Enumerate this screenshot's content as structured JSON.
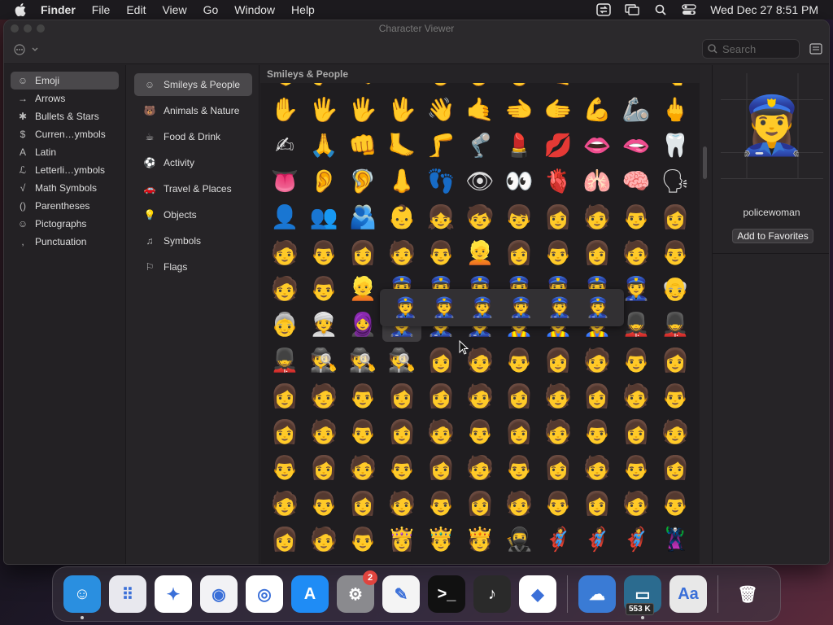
{
  "menubar": {
    "app": "Finder",
    "items": [
      "File",
      "Edit",
      "View",
      "Go",
      "Window",
      "Help"
    ],
    "clock": "Wed Dec 27  8:51 PM"
  },
  "window": {
    "title": "Character Viewer",
    "search_placeholder": "Search"
  },
  "sidebar_primary": [
    {
      "icon": "☺",
      "label": "Emoji"
    },
    {
      "icon": "→",
      "label": "Arrows"
    },
    {
      "icon": "✱",
      "label": "Bullets & Stars"
    },
    {
      "icon": "$",
      "label": "Curren…ymbols"
    },
    {
      "icon": "A",
      "label": "Latin"
    },
    {
      "icon": "ℒ",
      "label": "Letterli…ymbols"
    },
    {
      "icon": "√",
      "label": "Math Symbols"
    },
    {
      "icon": "()",
      "label": "Parentheses"
    },
    {
      "icon": "☺",
      "label": "Pictographs"
    },
    {
      "icon": ",",
      "label": "Punctuation"
    }
  ],
  "sidebar_secondary": [
    {
      "icon": "☺",
      "label": "Smileys & People"
    },
    {
      "icon": "🐻",
      "label": "Animals & Nature"
    },
    {
      "icon": "☕",
      "label": "Food & Drink"
    },
    {
      "icon": "⚽",
      "label": "Activity"
    },
    {
      "icon": "🚗",
      "label": "Travel & Places"
    },
    {
      "icon": "💡",
      "label": "Objects"
    },
    {
      "icon": "♫",
      "label": "Symbols"
    },
    {
      "icon": "⚐",
      "label": "Flags"
    }
  ],
  "grid": {
    "header": "Smileys & People",
    "emojis": [
      "👌",
      "🤌",
      "🤏",
      "✌",
      "🤞",
      "🤟",
      "🤘",
      "🤙",
      "👈",
      "👉",
      "👆",
      "✋",
      "🖐",
      "🖐",
      "🖖",
      "👋",
      "🤙",
      "🫲",
      "🫱",
      "💪",
      "🦾",
      "🖕",
      "✍",
      "🙏",
      "👊",
      "🦶",
      "🦵",
      "🦿",
      "💄",
      "💋",
      "👄",
      "🫦",
      "🦷",
      "👅",
      "👂",
      "🦻",
      "👃",
      "👣",
      "👁",
      "👀",
      "🫀",
      "🫁",
      "🧠",
      "🗣",
      "👤",
      "👥",
      "🫂",
      "👶",
      "👧",
      "🧒",
      "👦",
      "👩",
      "🧑",
      "👨",
      "👩",
      "🧑",
      "👨",
      "👩",
      "🧑",
      "👨",
      "👱",
      "👩",
      "👨",
      "👩",
      "🧑",
      "👨",
      "🧑",
      "👨",
      "👱",
      "👮",
      "👮",
      "👮",
      "👮",
      "👮",
      "👮",
      "👮",
      "👴",
      "👵",
      "👳",
      "🧕",
      "👮",
      "👮",
      "👮",
      "👷",
      "👷",
      "👷",
      "💂",
      "💂",
      "💂",
      "🕵",
      "🕵",
      "🕵",
      "👩",
      "🧑",
      "👨",
      "👩",
      "🧑",
      "👨",
      "👩",
      "👩",
      "🧑",
      "👨",
      "👩",
      "👩",
      "🧑",
      "👩",
      "🧑",
      "👩",
      "🧑",
      "👨",
      "👩",
      "🧑",
      "👨",
      "👩",
      "🧑",
      "👨",
      "👩",
      "🧑",
      "👨",
      "👩",
      "🧑",
      "👨",
      "👩",
      "🧑",
      "👨",
      "👩",
      "🧑",
      "👨",
      "👩",
      "🧑",
      "👨",
      "👩",
      "🧑",
      "👨",
      "👩",
      "🧑",
      "👨",
      "👩",
      "🧑",
      "👨",
      "👩",
      "🧑",
      "👨",
      "👩",
      "🧑",
      "👨",
      "👸",
      "🤴",
      "🫅",
      "🥷",
      "🦸",
      "🦸",
      "🦸",
      "🦹"
    ],
    "selected_index": 80,
    "skin_tone_popover": [
      "👮",
      "👮",
      "👮",
      "👮",
      "👮",
      "👮"
    ]
  },
  "detail": {
    "emoji": "👮‍♀️",
    "name": "policewoman",
    "favorites_label": "Add to Favorites"
  },
  "dock": [
    {
      "name": "finder",
      "bg": "#2a8fe0"
    },
    {
      "name": "launchpad",
      "bg": "#e8e8ee"
    },
    {
      "name": "safari",
      "bg": "#ffffff"
    },
    {
      "name": "firefox",
      "bg": "#f2f2f5"
    },
    {
      "name": "chrome",
      "bg": "#ffffff"
    },
    {
      "name": "app-store",
      "bg": "#1f8cf5"
    },
    {
      "name": "system-settings",
      "bg": "#8a8a8e",
      "badge": "2"
    },
    {
      "name": "textedit",
      "bg": "#f4f4f4"
    },
    {
      "name": "terminal",
      "bg": "#111111"
    },
    {
      "name": "garageband",
      "bg": "#2a2a2a"
    },
    {
      "name": "vscode",
      "bg": "#ffffff"
    },
    {
      "name": "weather",
      "bg": "#3a7bd5"
    },
    {
      "name": "network-monitor",
      "bg": "#2b6b8f",
      "net": "553 K"
    },
    {
      "name": "font-book",
      "bg": "#e8e8e8"
    },
    {
      "name": "trash",
      "bg": "transparent"
    }
  ]
}
